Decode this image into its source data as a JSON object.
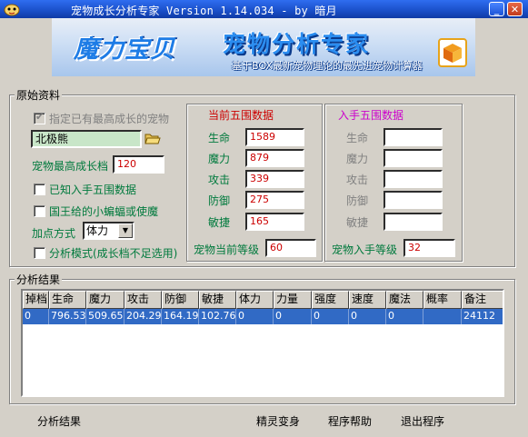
{
  "window": {
    "title": "宠物成长分析专家 Version 1.14.034 - by 暗月",
    "minimize_glyph": "_",
    "close_glyph": "✕"
  },
  "banner": {
    "logo": "魔力宝贝",
    "title": "宠物分析专家",
    "subtitle": "基于BOX最新宠物理论的最先进宠物计算器"
  },
  "source_group": {
    "label": "原始资料",
    "specify_growth_label": "指定已有最高成长的宠物",
    "pet_name": "北极熊",
    "max_growth_label": "宠物最高成长档",
    "max_growth_value": "120",
    "known_stats_label": "已知入手五围数据",
    "king_bat_label": "国王给的小蝙蝠或使魔",
    "add_method_label": "加点方式",
    "add_method_value": "体力",
    "analysis_mode_label": "分析模式(成长档不足选用)"
  },
  "current_stats": {
    "header": "当前五围数据",
    "rows": [
      {
        "label": "生命",
        "value": "1589"
      },
      {
        "label": "魔力",
        "value": "879"
      },
      {
        "label": "攻击",
        "value": "339"
      },
      {
        "label": "防御",
        "value": "275"
      },
      {
        "label": "敏捷",
        "value": "165"
      }
    ],
    "level_label": "宠物当前等级",
    "level_value": "60"
  },
  "initial_stats": {
    "header": "入手五围数据",
    "rows": [
      {
        "label": "生命",
        "value": ""
      },
      {
        "label": "魔力",
        "value": ""
      },
      {
        "label": "攻击",
        "value": ""
      },
      {
        "label": "防御",
        "value": ""
      },
      {
        "label": "敏捷",
        "value": ""
      }
    ],
    "level_label": "宠物入手等级",
    "level_value": "32"
  },
  "results": {
    "label": "分析结果",
    "columns": [
      "掉档",
      "生命",
      "魔力",
      "攻击",
      "防御",
      "敏捷",
      "体力",
      "力量",
      "强度",
      "速度",
      "魔法",
      "概率",
      "备注"
    ],
    "rows": [
      [
        "0",
        "796.53",
        "509.65",
        "204.29",
        "164.19",
        "102.76",
        "0",
        "0",
        "0",
        "0",
        "0",
        "",
        "24112"
      ]
    ]
  },
  "buttons": {
    "analyze": "分析结果",
    "transform": "精灵变身",
    "help": "程序帮助",
    "exit": "退出程序"
  }
}
